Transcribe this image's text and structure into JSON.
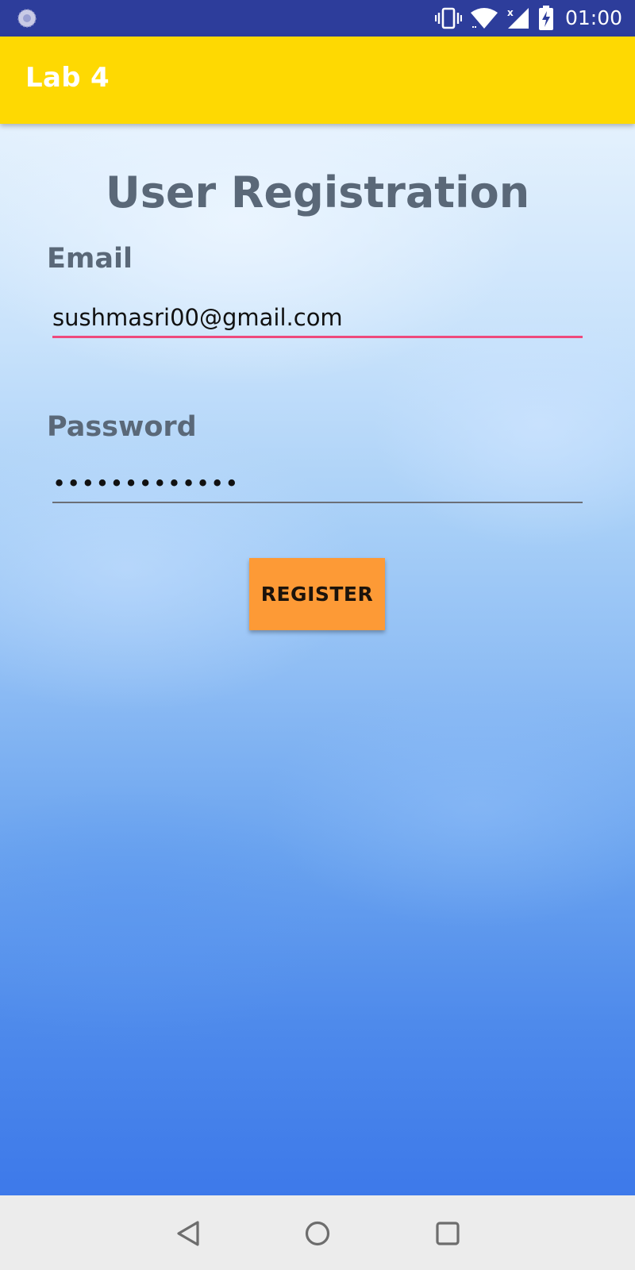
{
  "status_bar": {
    "time": "01:00",
    "icons": [
      "app-notification-icon",
      "vibrate-icon",
      "wifi-icon",
      "signal-no-data-icon",
      "battery-charging-icon"
    ]
  },
  "app_bar": {
    "title": "Lab 4",
    "color": "#fed902"
  },
  "form": {
    "title": "User Registration",
    "email_label": "Email",
    "email_value": "sushmasri00@gmail.com",
    "password_label": "Password",
    "password_value": "•••••••••••••",
    "register_label": "REGISTER",
    "accent_color": "#ee4a7d",
    "button_color": "#fd9a36"
  },
  "nav_bar": {
    "icons": [
      "back-icon",
      "home-icon",
      "recents-icon"
    ]
  }
}
